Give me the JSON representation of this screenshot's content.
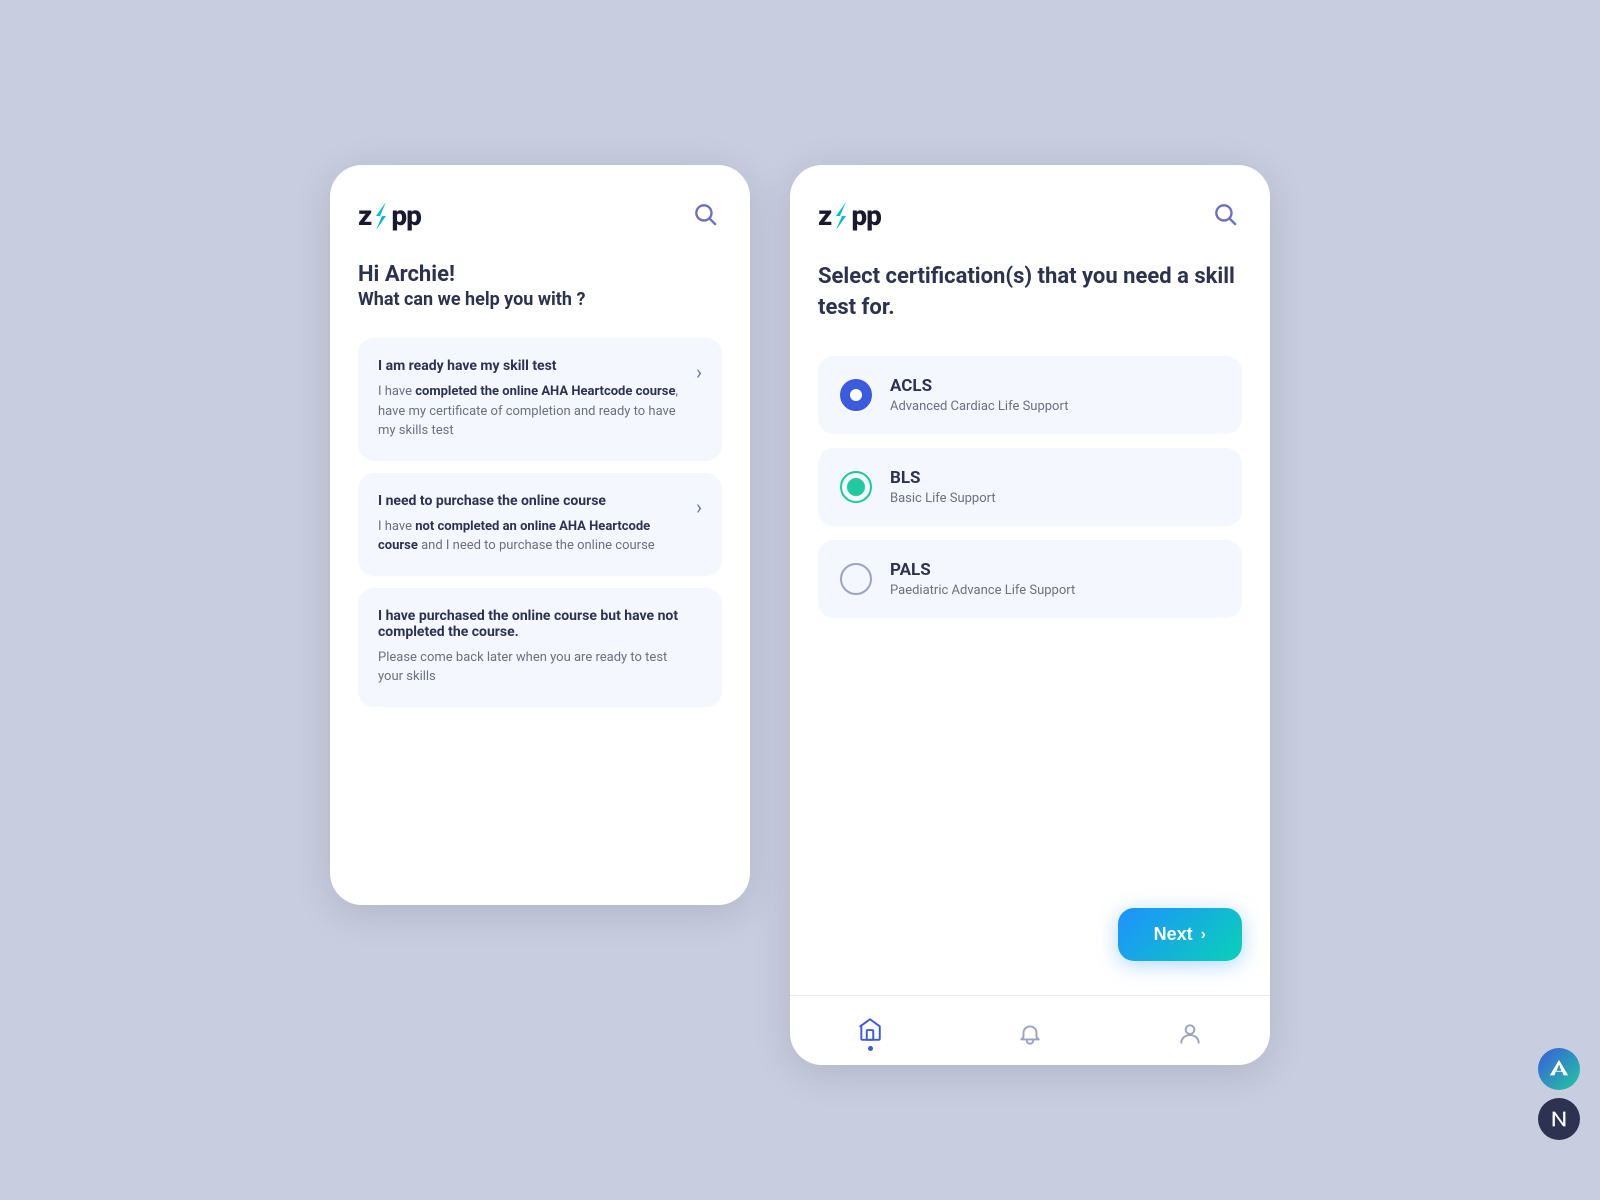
{
  "app": {
    "name": "zApp",
    "logo_text_before": "z",
    "logo_text_after": "pp"
  },
  "left_phone": {
    "greeting": {
      "hi": "Hi Archie!",
      "sub": "What can we help you with ?"
    },
    "menu_items": [
      {
        "title": "I am ready have my skill test",
        "desc_parts": [
          {
            "text": "I have "
          },
          {
            "text": "completed the online AHA Heartcode course",
            "bold": true
          },
          {
            "text": ", have my certificate of completion and ready to have my skills test"
          }
        ]
      },
      {
        "title": "I need to purchase the online course",
        "desc_parts": [
          {
            "text": "I have "
          },
          {
            "text": "not completed an online AHA Heartcode course",
            "bold": true
          },
          {
            "text": " and I need to purchase the online course"
          }
        ]
      },
      {
        "title": "I have purchased the online course but have not completed the course.",
        "desc_parts": [
          {
            "text": "Please come back later when you are ready to test your skills"
          }
        ]
      }
    ]
  },
  "right_phone": {
    "section_title": "Select certification(s) that you need a skill test for.",
    "certifications": [
      {
        "id": "acls",
        "name": "ACLS",
        "desc": "Advanced Cardiac Life Support",
        "state": "selected-blue"
      },
      {
        "id": "bls",
        "name": "BLS",
        "desc": "Basic Life Support",
        "state": "selected-teal"
      },
      {
        "id": "pals",
        "name": "PALS",
        "desc": "Paediatric Advance Life Support",
        "state": "unselected"
      }
    ],
    "next_button": "Next",
    "nav": {
      "items": [
        "home",
        "bell",
        "user"
      ]
    }
  }
}
